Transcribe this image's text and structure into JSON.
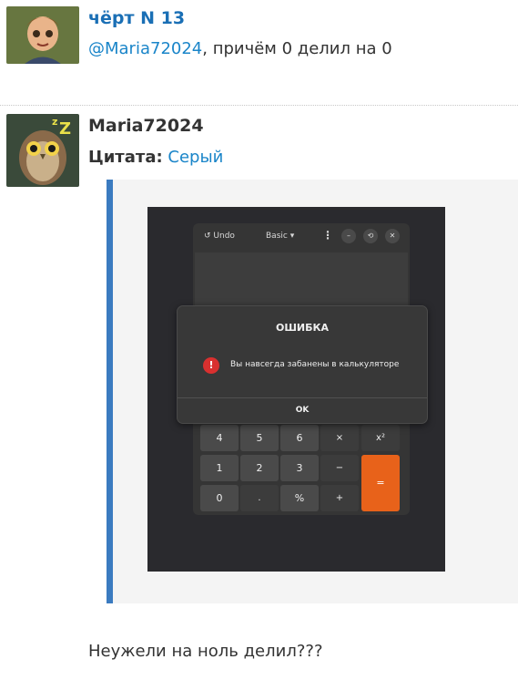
{
  "posts": [
    {
      "author": "чёрт N 13",
      "mention": "@Maria72024",
      "text_after_mention": ", причём 0 делил на 0"
    },
    {
      "author": "Maria72024",
      "quote_label": "Цитата:",
      "quote_author": "Серый",
      "embedded_screenshot": {
        "toolbar": {
          "undo": "↺ Undo",
          "mode": "Basic ▾",
          "menu": "⋮",
          "minimize": "–",
          "restore": "⟲",
          "close": "✕"
        },
        "dialog": {
          "title": "ОШИБКА",
          "icon": "!",
          "message": "Вы навсегда забанены в калькуляторе",
          "button": "OK"
        },
        "keys": {
          "k4": "4",
          "k5": "5",
          "k6": "6",
          "mul": "×",
          "pow": "x²",
          "k1": "1",
          "k2": "2",
          "k3": "3",
          "minus": "−",
          "eq": "=",
          "k0": "0",
          "dot": ".",
          "pct": "%",
          "plus": "+"
        }
      },
      "text": "Неужели на ноль делил???"
    }
  ]
}
